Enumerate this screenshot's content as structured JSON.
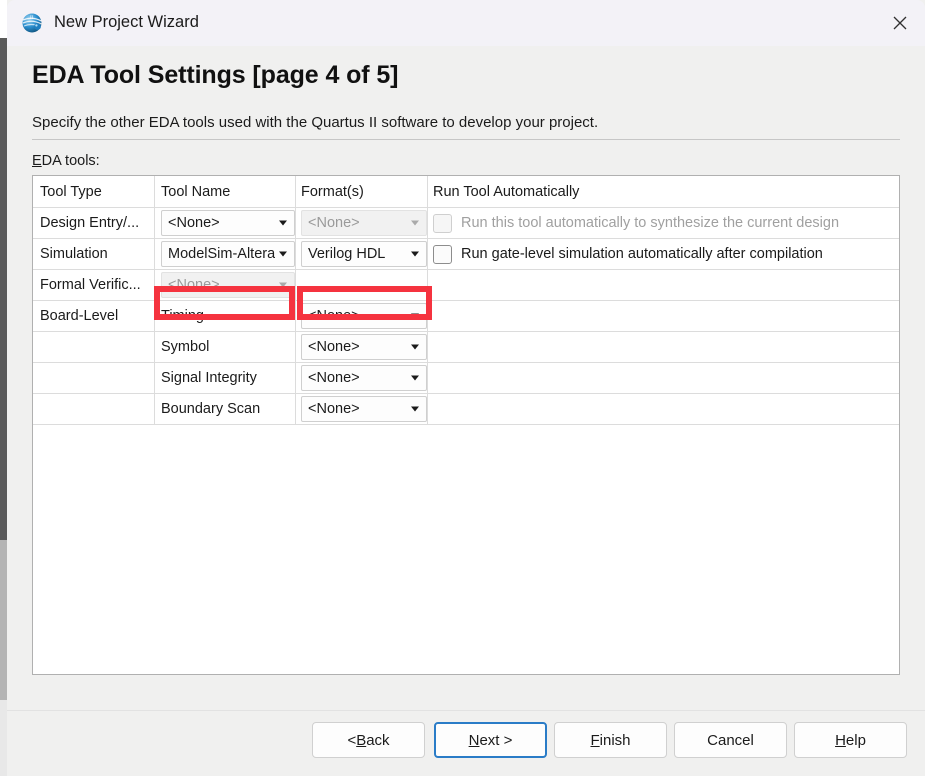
{
  "window": {
    "title": "New Project Wizard",
    "icon": "quartus-logo-icon",
    "close_label": "✕"
  },
  "page": {
    "title": "EDA Tool Settings [page 4 of 5]",
    "subtitle": "Specify the other EDA tools used with the Quartus II software to develop your project.",
    "section_label_accel": "E",
    "section_label_rest": "DA tools:"
  },
  "table": {
    "headers": {
      "tool_type": "Tool Type",
      "tool_name": "Tool Name",
      "formats": "Format(s)",
      "run_tool": "Run Tool Automatically"
    },
    "rows": [
      {
        "tool_type": "Design Entry/...",
        "tool_name": "<None>",
        "tool_name_disabled": false,
        "format": "<None>",
        "format_disabled": true,
        "has_checkbox": true,
        "checkbox_checked": false,
        "checkbox_disabled": true,
        "run_label": "Run this tool automatically to synthesize the current design"
      },
      {
        "tool_type": "Simulation",
        "tool_name": "ModelSim-Altera",
        "tool_name_disabled": false,
        "format": "Verilog HDL",
        "format_disabled": false,
        "has_checkbox": true,
        "checkbox_checked": false,
        "checkbox_disabled": false,
        "run_label": "Run gate-level simulation automatically after compilation"
      },
      {
        "tool_type": "Formal Verific...",
        "tool_name": "<None>",
        "tool_name_disabled": true,
        "format": "",
        "format_disabled": false,
        "has_checkbox": false,
        "checkbox_checked": false,
        "checkbox_disabled": false,
        "run_label": ""
      },
      {
        "tool_type": "Board-Level",
        "tool_name": "Timing",
        "tool_name_disabled": false,
        "tool_name_plain": true,
        "format": "<None>",
        "format_disabled": false,
        "has_checkbox": false,
        "checkbox_checked": false,
        "checkbox_disabled": false,
        "run_label": ""
      },
      {
        "tool_type": "",
        "tool_name": "Symbol",
        "tool_name_disabled": false,
        "tool_name_plain": true,
        "format": "<None>",
        "format_disabled": false,
        "has_checkbox": false,
        "checkbox_checked": false,
        "checkbox_disabled": false,
        "run_label": ""
      },
      {
        "tool_type": "",
        "tool_name": "Signal Integrity",
        "tool_name_disabled": false,
        "tool_name_plain": true,
        "format": "<None>",
        "format_disabled": false,
        "has_checkbox": false,
        "checkbox_checked": false,
        "checkbox_disabled": false,
        "run_label": ""
      },
      {
        "tool_type": "",
        "tool_name": "Boundary Scan",
        "tool_name_disabled": false,
        "tool_name_plain": true,
        "format": "<None>",
        "format_disabled": false,
        "has_checkbox": false,
        "checkbox_checked": false,
        "checkbox_disabled": false,
        "run_label": ""
      }
    ]
  },
  "annotations": {
    "color": "#f5333f",
    "boxes": [
      {
        "name": "tool-name-highlight",
        "target": "ModelSim-Altera"
      },
      {
        "name": "format-highlight",
        "target": "Verilog HDL"
      }
    ]
  },
  "buttons": {
    "back": {
      "pre": "< ",
      "accel": "B",
      "post": "ack"
    },
    "next": {
      "pre": "",
      "accel": "N",
      "post": "ext >"
    },
    "finish": {
      "pre": "",
      "accel": "F",
      "post": "inish"
    },
    "cancel": {
      "pre": "",
      "accel": "",
      "post": "Cancel"
    },
    "help": {
      "pre": "",
      "accel": "H",
      "post": "elp"
    }
  }
}
